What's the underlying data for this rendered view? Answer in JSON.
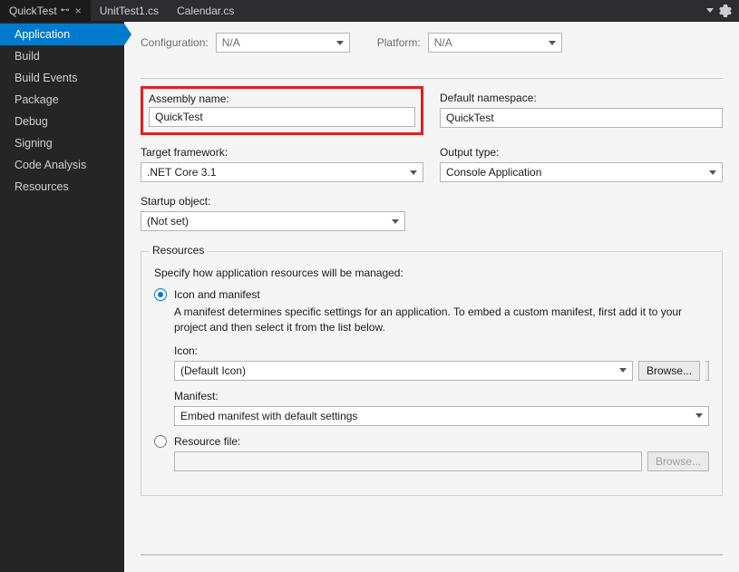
{
  "tabs": {
    "items": [
      {
        "label": "QuickTest",
        "active": true,
        "pinned": true,
        "close": true
      },
      {
        "label": "UnitTest1.cs",
        "active": false
      },
      {
        "label": "Calendar.cs",
        "active": false
      }
    ]
  },
  "sidebar": {
    "items": [
      {
        "label": "Application",
        "active": true
      },
      {
        "label": "Build"
      },
      {
        "label": "Build Events"
      },
      {
        "label": "Package"
      },
      {
        "label": "Debug"
      },
      {
        "label": "Signing"
      },
      {
        "label": "Code Analysis"
      },
      {
        "label": "Resources"
      }
    ]
  },
  "config": {
    "configuration_label": "Configuration:",
    "configuration_value": "N/A",
    "platform_label": "Platform:",
    "platform_value": "N/A"
  },
  "app": {
    "assembly_label": "Assembly name:",
    "assembly_value": "QuickTest",
    "namespace_label": "Default namespace:",
    "namespace_value": "QuickTest",
    "framework_label": "Target framework:",
    "framework_value": ".NET Core 3.1",
    "output_label": "Output type:",
    "output_value": "Console Application",
    "startup_label": "Startup object:",
    "startup_value": "(Not set)"
  },
  "resources": {
    "group_title": "Resources",
    "description": "Specify how application resources will be managed:",
    "opt_icon_label": "Icon and manifest",
    "opt_icon_desc": "A manifest determines specific settings for an application. To embed a custom manifest, first add it to your project and then select it from the list below.",
    "icon_label": "Icon:",
    "icon_value": "(Default Icon)",
    "manifest_label": "Manifest:",
    "manifest_value": "Embed manifest with default settings",
    "opt_file_label": "Resource file:",
    "browse_label": "Browse..."
  }
}
